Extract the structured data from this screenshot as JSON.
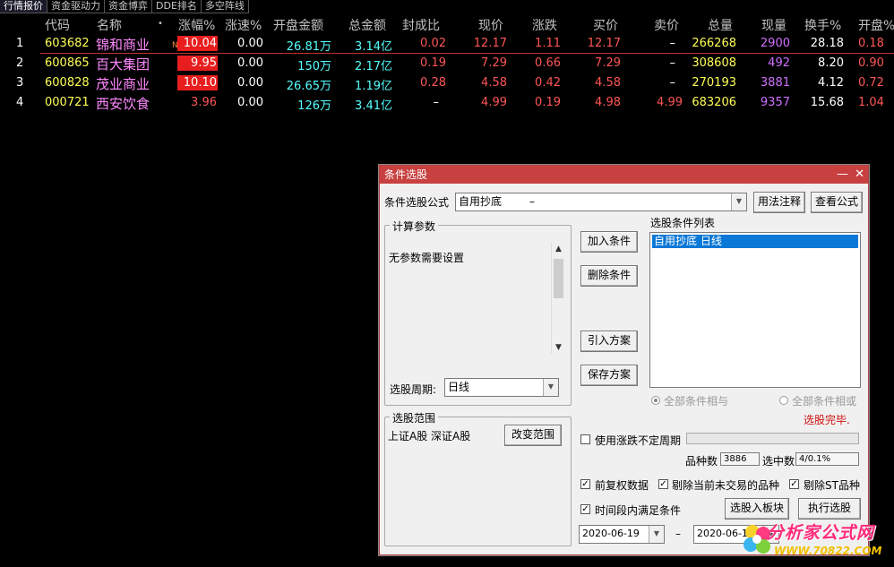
{
  "tabs": [
    "行情报价",
    "资金驱动力",
    "资金博弈",
    "DDE排名",
    "多空阵线"
  ],
  "columns": {
    "code": "代码",
    "name": "名称",
    "dot": "•",
    "chg_pct": "涨幅%",
    "speed_pct": "涨速%",
    "open_amount": "开盘金额",
    "total_amount": "总金额",
    "seal_ratio": "封成比",
    "price": "现价",
    "change": "涨跌",
    "bid": "买价",
    "ask": "卖价",
    "volume": "总量",
    "cur_vol": "现量",
    "turnover": "换手%",
    "open_pct": "开盘%"
  },
  "rows": [
    {
      "idx": "1",
      "code": "603682",
      "name": "锦和商业",
      "flag": "N",
      "chg_pct": "10.04",
      "speed_pct": "0.00",
      "open_amount": "26.81万",
      "total_amount": "3.14亿",
      "seal_ratio": "0.02",
      "price": "12.17",
      "change": "1.11",
      "bid": "12.17",
      "ask": "–",
      "volume": "266268",
      "cur_vol": "2900",
      "turnover": "28.18",
      "open_pct": "0.18"
    },
    {
      "idx": "2",
      "code": "600865",
      "name": "百大集团",
      "flag": "",
      "chg_pct": "9.95",
      "speed_pct": "0.00",
      "open_amount": "150万",
      "total_amount": "2.17亿",
      "seal_ratio": "0.19",
      "price": "7.29",
      "change": "0.66",
      "bid": "7.29",
      "ask": "–",
      "volume": "308608",
      "cur_vol": "492",
      "turnover": "8.20",
      "open_pct": "0.90"
    },
    {
      "idx": "3",
      "code": "600828",
      "name": "茂业商业",
      "flag": "",
      "chg_pct": "10.10",
      "speed_pct": "0.00",
      "open_amount": "26.65万",
      "total_amount": "1.19亿",
      "seal_ratio": "0.28",
      "price": "4.58",
      "change": "0.42",
      "bid": "4.58",
      "ask": "–",
      "volume": "270193",
      "cur_vol": "3881",
      "turnover": "4.12",
      "open_pct": "0.72"
    },
    {
      "idx": "4",
      "code": "000721",
      "name": "西安饮食",
      "flag": "",
      "chg_pct": "3.96",
      "speed_pct": "0.00",
      "open_amount": "126万",
      "total_amount": "3.41亿",
      "seal_ratio": "–",
      "price": "4.99",
      "change": "0.19",
      "bid": "4.98",
      "ask": "4.99",
      "volume": "683206",
      "cur_vol": "9357",
      "turnover": "15.68",
      "open_pct": "1.04"
    }
  ],
  "dialog": {
    "title": "条件选股",
    "minimize": "—",
    "close": "✕",
    "formula_label": "条件选股公式",
    "formula_value": "自用抄底",
    "formula_dash": "–",
    "usage_btn": "用法注释",
    "view_formula_btn": "查看公式",
    "params_group": "计算参数",
    "params_text": "无参数需要设置",
    "period_label": "选股周期:",
    "period_value": "日线",
    "add_cond_btn": "加入条件",
    "del_cond_btn": "删除条件",
    "import_btn": "引入方案",
    "save_btn": "保存方案",
    "cond_list_label": "选股条件列表",
    "cond_items": [
      "自用抄底   日线"
    ],
    "radio_and": "全部条件相与",
    "radio_or": "全部条件相或",
    "status": "选股完毕.",
    "scope_group": "选股范围",
    "scope_text": "上证A股  深证A股",
    "change_scope_btn": "改变范围",
    "use_var_period": "使用涨跌不定周期",
    "count_label": "品种数",
    "count_value": "3886",
    "selected_label": "选中数",
    "selected_value": "4/0.1%",
    "pre_adjust": "前复权数据",
    "exclude_untraded": "剔除当前未交易的品种",
    "exclude_st": "剔除ST品种",
    "time_cond": "时间段内满足条件",
    "to_block_btn": "选股入板块",
    "run_btn": "执行选股",
    "date_from": "2020-06-19",
    "date_sep": "–",
    "date_to": "2020-06-19"
  },
  "watermark": {
    "title": "分析家公式网",
    "url": "WWW.70822.COM"
  },
  "colors": {
    "code": "#ffff54",
    "name": "#ff88ff",
    "up": "#ff5555",
    "amount": "#54ffff",
    "cur_vol": "#d070ff",
    "dialog_title": "#c84040",
    "list_select": "#0a78d7"
  }
}
